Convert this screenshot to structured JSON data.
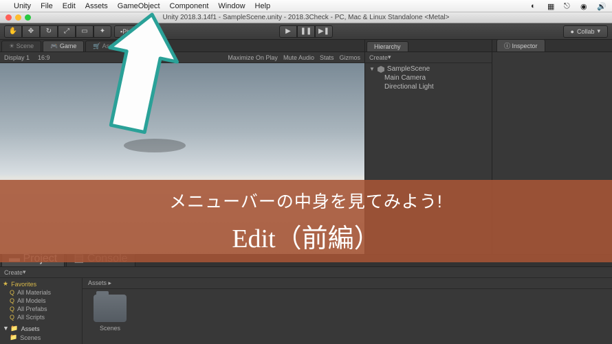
{
  "mac_menu": {
    "items": [
      "Unity",
      "File",
      "Edit",
      "Assets",
      "GameObject",
      "Component",
      "Window",
      "Help"
    ]
  },
  "window_title": "Unity 2018.3.14f1 - SampleScene.unity - 2018.3Check - PC, Mac & Linux Standalone <Metal>",
  "toolbar": {
    "pivot": "Pivot",
    "collab": "Collab"
  },
  "tabs": {
    "scene": "Scene",
    "game": "Game",
    "asset_store": "Asset Store",
    "hierarchy": "Hierarchy",
    "inspector": "Inspector",
    "project": "Project",
    "console": "Console"
  },
  "game_ctl": {
    "display": "Display 1",
    "aspect": "16:9",
    "max_on_play": "Maximize On Play",
    "mute": "Mute Audio",
    "stats": "Stats",
    "gizmos": "Gizmos"
  },
  "hierarchy": {
    "create": "Create",
    "root": "SampleScene",
    "children": [
      "Main Camera",
      "Directional Light"
    ]
  },
  "project": {
    "create": "Create",
    "favorites": "Favorites",
    "fav_items": [
      "All Materials",
      "All Models",
      "All Prefabs",
      "All Scripts"
    ],
    "assets": "Assets",
    "assets_children": [
      "Scenes"
    ],
    "breadcrumb": "Assets",
    "folder": "Scenes"
  },
  "overlay": {
    "line1": "メニューバーの中身を見てみよう!",
    "line2": "Edit（前編）"
  }
}
